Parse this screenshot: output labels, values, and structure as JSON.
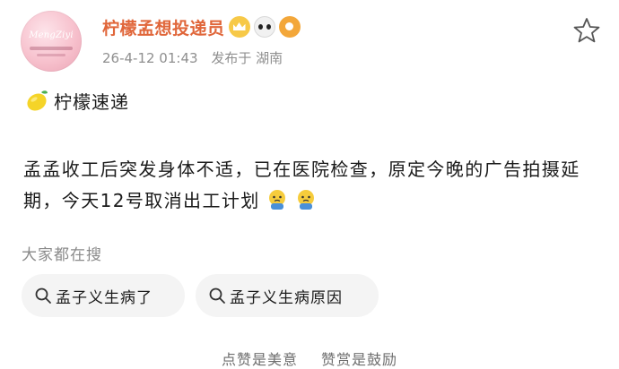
{
  "author": {
    "name": "柠檬孟想投递员",
    "avatar_text": "MengZiyi",
    "badges": [
      "crown-badge-icon",
      "panda-badge-icon",
      "fish-badge-icon"
    ],
    "post_time": "26-4-12 01:43",
    "location": "发布于 湖南"
  },
  "post": {
    "title": "柠檬速递",
    "body": "孟孟收工后突发身体不适，已在医院检查，原定今晚的广告拍摄延期，今天12号取消出工计划"
  },
  "search": {
    "heading": "大家都在搜",
    "chips": [
      "孟子义生病了",
      "孟子义生病原因"
    ]
  },
  "footer": {
    "text_left": "点赞是美意",
    "text_right": "赞赏是鼓励"
  },
  "colors": {
    "username": "#e0663a",
    "meta": "#8f8f8f",
    "chip_bg": "#f4f4f4"
  }
}
